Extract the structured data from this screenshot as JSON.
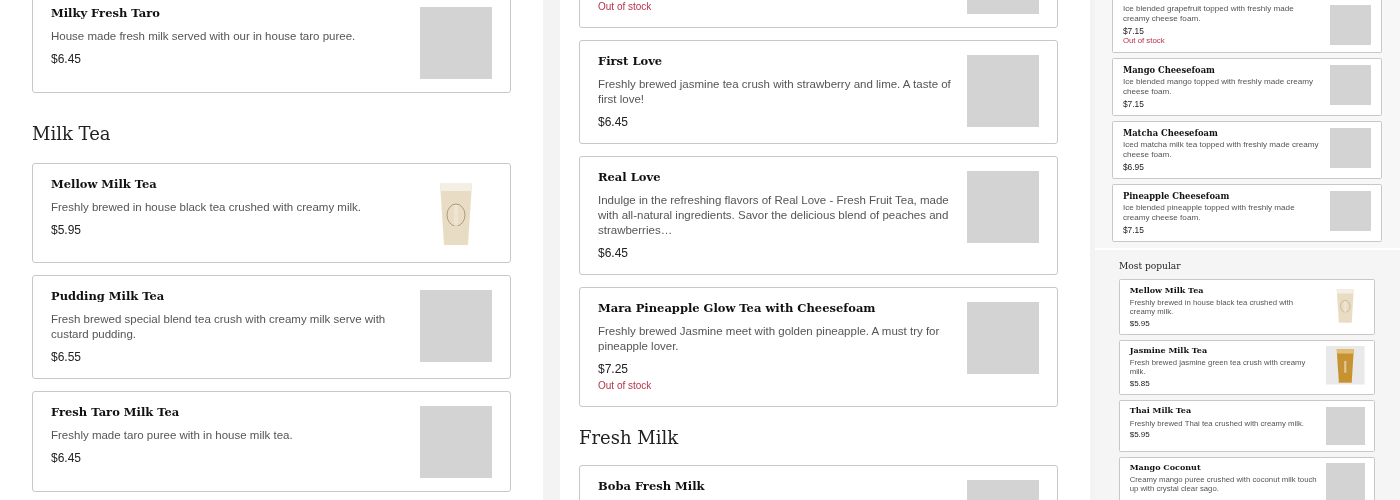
{
  "panels": [
    {
      "sections": [
        {
          "items": [
            {
              "name": "Milky Fresh Taro",
              "description": "House made fresh milk served with our in house taro puree.",
              "price": "$6.45",
              "kind": "blank"
            }
          ]
        },
        {
          "heading": "Milk Tea",
          "items": [
            {
              "name": "Mellow Milk Tea",
              "description": "Freshly brewed in house black tea crushed with creamy milk.",
              "price": "$5.95",
              "kind": "milky"
            },
            {
              "name": "Pudding Milk Tea",
              "description": "Fresh brewed special blend tea crush with creamy milk serve with custard pudding.",
              "price": "$6.55",
              "kind": "blank"
            },
            {
              "name": "Fresh Taro Milk Tea",
              "description": "Freshly made taro puree with in house milk tea.",
              "price": "$6.45",
              "kind": "blank"
            }
          ]
        }
      ]
    },
    {
      "sections": [
        {
          "items": [
            {
              "stock_note": "Out of stock",
              "kind": "blank"
            },
            {
              "name": "First Love",
              "description": "Freshly brewed jasmine tea crush with strawberry and lime. A taste of first love!",
              "price": "$6.45",
              "kind": "blank"
            },
            {
              "name": "Real Love",
              "description": "Indulge in the refreshing flavors of Real Love - Fresh Fruit Tea, made with all-natural ingredients. Savor the delicious blend of peaches and strawberries…",
              "price": "$6.45",
              "kind": "blank"
            },
            {
              "name": "Mara Pineapple Glow Tea with Cheesefoam",
              "description": "Freshly brewed Jasmine meet with golden pineapple. A must try for pineapple lover.",
              "price": "$7.25",
              "stock_note": "Out of stock",
              "kind": "blank"
            }
          ]
        },
        {
          "heading": "Fresh Milk",
          "items": [
            {
              "name": "Boba Fresh Milk",
              "kind": "blank"
            }
          ]
        }
      ]
    },
    {
      "sections": [
        {
          "items": [
            {
              "description": "Ice blended grapefruit topped with freshly made creamy cheese foam.",
              "price": "$7.15",
              "stock_note": "Out of stock",
              "kind": "blank"
            },
            {
              "name": "Mango Cheesefoam",
              "description": "Ice blended mango topped with freshly made creamy cheese foam.",
              "price": "$7.15",
              "kind": "blank"
            },
            {
              "name": "Matcha Cheesefoam",
              "description": "Iced matcha milk tea topped with freshly made creamy cheese foam.",
              "price": "$6.95",
              "kind": "blank"
            },
            {
              "name": "Pineapple Cheesefoam",
              "description": "Ice blended pineapple topped with freshly made creamy cheese foam.",
              "price": "$7.15",
              "kind": "blank"
            }
          ]
        }
      ]
    },
    {
      "sections": [
        {
          "heading": "Most popular",
          "items": [
            {
              "name": "Mellow Milk Tea",
              "description": "Freshly brewed in house black tea crushed with creamy milk.",
              "price": "$5.95",
              "kind": "milky"
            },
            {
              "name": "Jasmine Milk Tea",
              "description": "Fresh brewed jasmine green tea crush with creamy milk.",
              "price": "$5.85",
              "kind": "golden"
            },
            {
              "name": "Thai Milk Tea",
              "description": "Freshly brewed Thai tea crushed with creamy milk.",
              "price": "$5.95",
              "kind": "blank"
            },
            {
              "name": "Mango Coconut",
              "description": "Creamy mango puree crushed with coconut milk touch up with crystal clear sago.",
              "kind": "blank"
            }
          ]
        }
      ]
    }
  ]
}
